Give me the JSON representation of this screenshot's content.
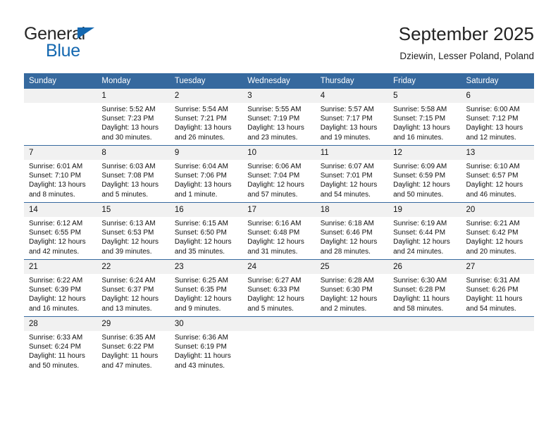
{
  "brand": {
    "name_part1": "General",
    "name_part2": "Blue",
    "triangle_color": "#1468b0"
  },
  "header": {
    "month_title": "September 2025",
    "location": "Dziewin, Lesser Poland, Poland"
  },
  "theme": {
    "header_blue": "#36699e",
    "daynum_gray": "#f1f1f1",
    "row_rule": "#36699e"
  },
  "calendar": {
    "weekday_headers": [
      "Sunday",
      "Monday",
      "Tuesday",
      "Wednesday",
      "Thursday",
      "Friday",
      "Saturday"
    ],
    "weeks": [
      [
        {
          "day": "",
          "sunrise": "",
          "sunset": "",
          "daylight1": "",
          "daylight2": ""
        },
        {
          "day": "1",
          "sunrise": "Sunrise: 5:52 AM",
          "sunset": "Sunset: 7:23 PM",
          "daylight1": "Daylight: 13 hours",
          "daylight2": "and 30 minutes."
        },
        {
          "day": "2",
          "sunrise": "Sunrise: 5:54 AM",
          "sunset": "Sunset: 7:21 PM",
          "daylight1": "Daylight: 13 hours",
          "daylight2": "and 26 minutes."
        },
        {
          "day": "3",
          "sunrise": "Sunrise: 5:55 AM",
          "sunset": "Sunset: 7:19 PM",
          "daylight1": "Daylight: 13 hours",
          "daylight2": "and 23 minutes."
        },
        {
          "day": "4",
          "sunrise": "Sunrise: 5:57 AM",
          "sunset": "Sunset: 7:17 PM",
          "daylight1": "Daylight: 13 hours",
          "daylight2": "and 19 minutes."
        },
        {
          "day": "5",
          "sunrise": "Sunrise: 5:58 AM",
          "sunset": "Sunset: 7:15 PM",
          "daylight1": "Daylight: 13 hours",
          "daylight2": "and 16 minutes."
        },
        {
          "day": "6",
          "sunrise": "Sunrise: 6:00 AM",
          "sunset": "Sunset: 7:12 PM",
          "daylight1": "Daylight: 13 hours",
          "daylight2": "and 12 minutes."
        }
      ],
      [
        {
          "day": "7",
          "sunrise": "Sunrise: 6:01 AM",
          "sunset": "Sunset: 7:10 PM",
          "daylight1": "Daylight: 13 hours",
          "daylight2": "and 8 minutes."
        },
        {
          "day": "8",
          "sunrise": "Sunrise: 6:03 AM",
          "sunset": "Sunset: 7:08 PM",
          "daylight1": "Daylight: 13 hours",
          "daylight2": "and 5 minutes."
        },
        {
          "day": "9",
          "sunrise": "Sunrise: 6:04 AM",
          "sunset": "Sunset: 7:06 PM",
          "daylight1": "Daylight: 13 hours",
          "daylight2": "and 1 minute."
        },
        {
          "day": "10",
          "sunrise": "Sunrise: 6:06 AM",
          "sunset": "Sunset: 7:04 PM",
          "daylight1": "Daylight: 12 hours",
          "daylight2": "and 57 minutes."
        },
        {
          "day": "11",
          "sunrise": "Sunrise: 6:07 AM",
          "sunset": "Sunset: 7:01 PM",
          "daylight1": "Daylight: 12 hours",
          "daylight2": "and 54 minutes."
        },
        {
          "day": "12",
          "sunrise": "Sunrise: 6:09 AM",
          "sunset": "Sunset: 6:59 PM",
          "daylight1": "Daylight: 12 hours",
          "daylight2": "and 50 minutes."
        },
        {
          "day": "13",
          "sunrise": "Sunrise: 6:10 AM",
          "sunset": "Sunset: 6:57 PM",
          "daylight1": "Daylight: 12 hours",
          "daylight2": "and 46 minutes."
        }
      ],
      [
        {
          "day": "14",
          "sunrise": "Sunrise: 6:12 AM",
          "sunset": "Sunset: 6:55 PM",
          "daylight1": "Daylight: 12 hours",
          "daylight2": "and 42 minutes."
        },
        {
          "day": "15",
          "sunrise": "Sunrise: 6:13 AM",
          "sunset": "Sunset: 6:53 PM",
          "daylight1": "Daylight: 12 hours",
          "daylight2": "and 39 minutes."
        },
        {
          "day": "16",
          "sunrise": "Sunrise: 6:15 AM",
          "sunset": "Sunset: 6:50 PM",
          "daylight1": "Daylight: 12 hours",
          "daylight2": "and 35 minutes."
        },
        {
          "day": "17",
          "sunrise": "Sunrise: 6:16 AM",
          "sunset": "Sunset: 6:48 PM",
          "daylight1": "Daylight: 12 hours",
          "daylight2": "and 31 minutes."
        },
        {
          "day": "18",
          "sunrise": "Sunrise: 6:18 AM",
          "sunset": "Sunset: 6:46 PM",
          "daylight1": "Daylight: 12 hours",
          "daylight2": "and 28 minutes."
        },
        {
          "day": "19",
          "sunrise": "Sunrise: 6:19 AM",
          "sunset": "Sunset: 6:44 PM",
          "daylight1": "Daylight: 12 hours",
          "daylight2": "and 24 minutes."
        },
        {
          "day": "20",
          "sunrise": "Sunrise: 6:21 AM",
          "sunset": "Sunset: 6:42 PM",
          "daylight1": "Daylight: 12 hours",
          "daylight2": "and 20 minutes."
        }
      ],
      [
        {
          "day": "21",
          "sunrise": "Sunrise: 6:22 AM",
          "sunset": "Sunset: 6:39 PM",
          "daylight1": "Daylight: 12 hours",
          "daylight2": "and 16 minutes."
        },
        {
          "day": "22",
          "sunrise": "Sunrise: 6:24 AM",
          "sunset": "Sunset: 6:37 PM",
          "daylight1": "Daylight: 12 hours",
          "daylight2": "and 13 minutes."
        },
        {
          "day": "23",
          "sunrise": "Sunrise: 6:25 AM",
          "sunset": "Sunset: 6:35 PM",
          "daylight1": "Daylight: 12 hours",
          "daylight2": "and 9 minutes."
        },
        {
          "day": "24",
          "sunrise": "Sunrise: 6:27 AM",
          "sunset": "Sunset: 6:33 PM",
          "daylight1": "Daylight: 12 hours",
          "daylight2": "and 5 minutes."
        },
        {
          "day": "25",
          "sunrise": "Sunrise: 6:28 AM",
          "sunset": "Sunset: 6:30 PM",
          "daylight1": "Daylight: 12 hours",
          "daylight2": "and 2 minutes."
        },
        {
          "day": "26",
          "sunrise": "Sunrise: 6:30 AM",
          "sunset": "Sunset: 6:28 PM",
          "daylight1": "Daylight: 11 hours",
          "daylight2": "and 58 minutes."
        },
        {
          "day": "27",
          "sunrise": "Sunrise: 6:31 AM",
          "sunset": "Sunset: 6:26 PM",
          "daylight1": "Daylight: 11 hours",
          "daylight2": "and 54 minutes."
        }
      ],
      [
        {
          "day": "28",
          "sunrise": "Sunrise: 6:33 AM",
          "sunset": "Sunset: 6:24 PM",
          "daylight1": "Daylight: 11 hours",
          "daylight2": "and 50 minutes."
        },
        {
          "day": "29",
          "sunrise": "Sunrise: 6:35 AM",
          "sunset": "Sunset: 6:22 PM",
          "daylight1": "Daylight: 11 hours",
          "daylight2": "and 47 minutes."
        },
        {
          "day": "30",
          "sunrise": "Sunrise: 6:36 AM",
          "sunset": "Sunset: 6:19 PM",
          "daylight1": "Daylight: 11 hours",
          "daylight2": "and 43 minutes."
        },
        {
          "day": "",
          "sunrise": "",
          "sunset": "",
          "daylight1": "",
          "daylight2": ""
        },
        {
          "day": "",
          "sunrise": "",
          "sunset": "",
          "daylight1": "",
          "daylight2": ""
        },
        {
          "day": "",
          "sunrise": "",
          "sunset": "",
          "daylight1": "",
          "daylight2": ""
        },
        {
          "day": "",
          "sunrise": "",
          "sunset": "",
          "daylight1": "",
          "daylight2": ""
        }
      ]
    ]
  }
}
